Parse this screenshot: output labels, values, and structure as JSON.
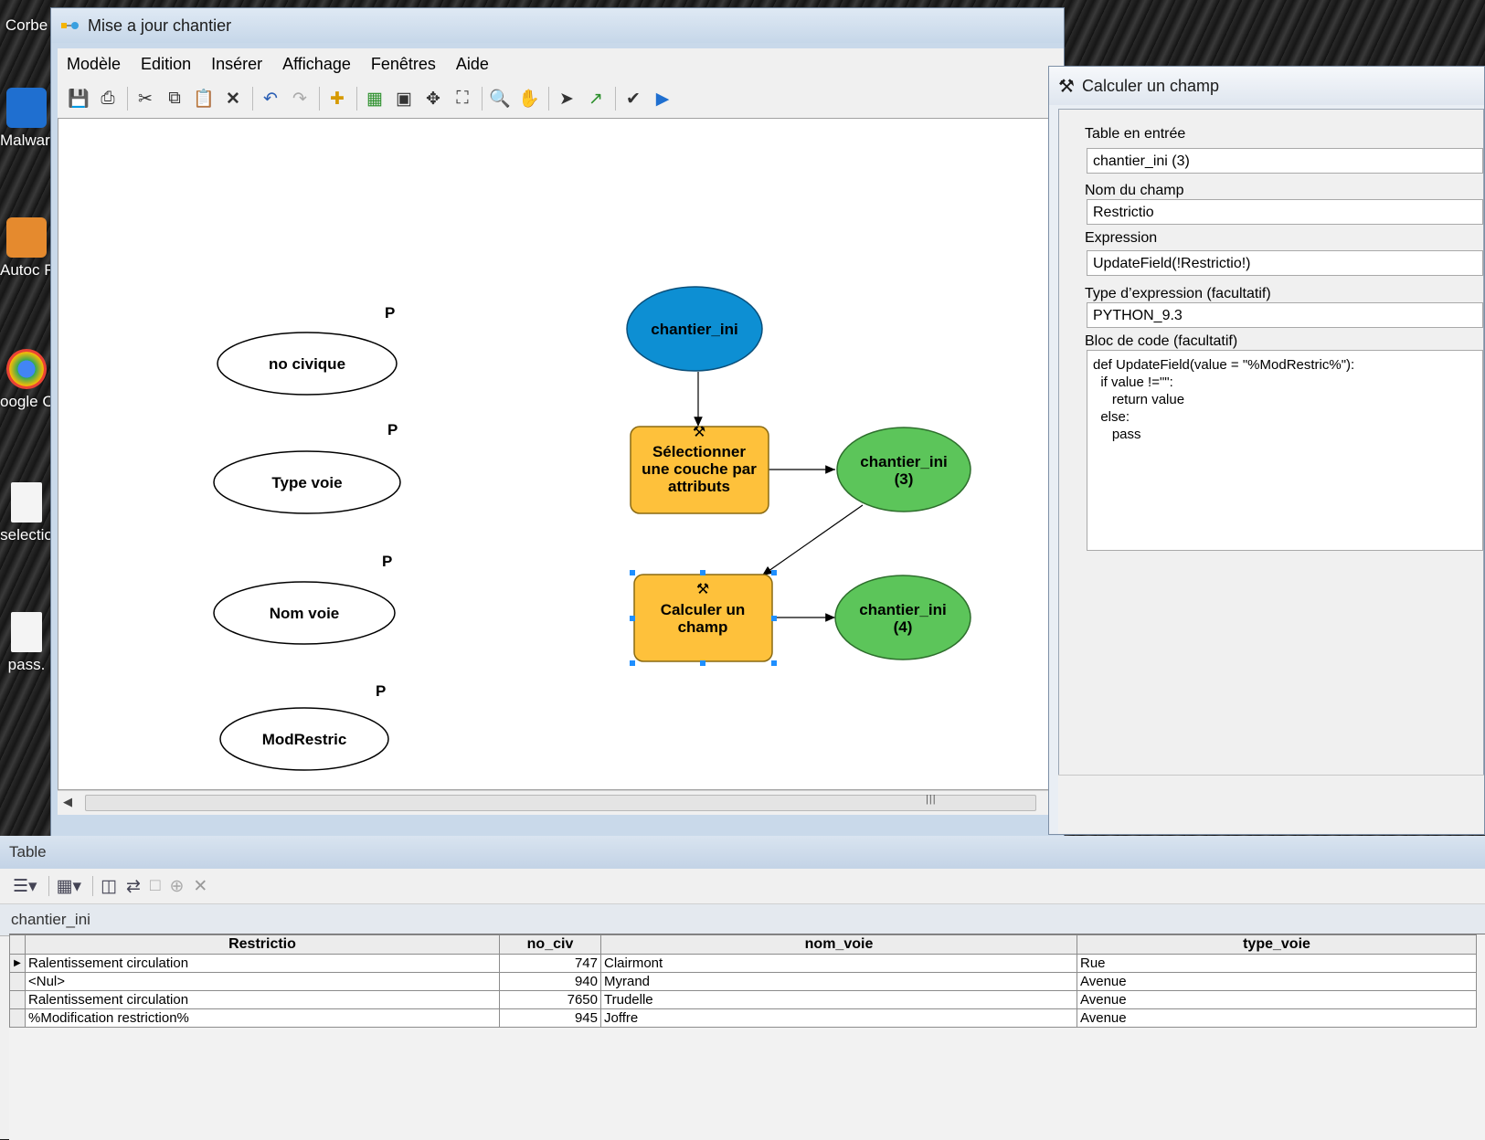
{
  "desktop": {
    "icons": [
      {
        "label": "Corbe"
      },
      {
        "label": "Malware"
      },
      {
        "label": "Autoc ReM"
      },
      {
        "label": "oogle C"
      },
      {
        "label": "selectio"
      },
      {
        "label": "pass."
      }
    ]
  },
  "model_window": {
    "title": "Mise a jour chantier",
    "menu": [
      "Modèle",
      "Edition",
      "Insérer",
      "Affichage",
      "Fenêtres",
      "Aide"
    ],
    "toolbar_icons": [
      "save-icon",
      "print-icon",
      "cut-icon",
      "copy-icon",
      "paste-icon",
      "delete-icon",
      "undo-icon",
      "redo-icon",
      "add-data-icon",
      "auto-layout-icon",
      "full-extent-icon",
      "zoom-in-fixed-icon",
      "zoom-out-fixed-icon",
      "zoom-in-icon",
      "pan-icon",
      "select-icon",
      "connect-icon",
      "validate-icon",
      "run-icon"
    ],
    "parameters": [
      {
        "label": "no civique",
        "badge": "P"
      },
      {
        "label": "Type voie",
        "badge": "P"
      },
      {
        "label": "Nom voie",
        "badge": "P"
      },
      {
        "label": "ModRestric",
        "badge": "P"
      }
    ],
    "nodes": {
      "input_data": "chantier_ini",
      "tool_select_lines": [
        "Sélectionner",
        "une couche par",
        "attributs"
      ],
      "output_select_lines": [
        "chantier_ini",
        "(3)"
      ],
      "tool_calc_lines": [
        "Calculer un",
        "champ"
      ],
      "output_calc_lines": [
        "chantier_ini",
        "(4)"
      ]
    },
    "colors": {
      "input_fill": "#0d8fd3",
      "tool_fill": "#fec13b",
      "output_fill": "#5cc55a",
      "parameter_fill": "#ffffff"
    }
  },
  "dialog": {
    "title": "Calculer un champ",
    "fields": {
      "table_label": "Table en entrée",
      "table_value": "chantier_ini (3)",
      "field_label": "Nom du champ",
      "field_value": "Restrictio",
      "expression_label": "Expression",
      "expression_value": "UpdateField(!Restrictio!)",
      "type_label": "Type d’expression (facultatif)",
      "type_value": "PYTHON_9.3",
      "code_label": "Bloc de code (facultatif)",
      "code_value": "def UpdateField(value = \"%ModRestric%\"):\n  if value !=\"\":\n     return value\n  else:\n     pass"
    }
  },
  "table_window": {
    "title": "Table",
    "tab_name": "chantier_ini",
    "columns": [
      "Restrictio",
      "no_civ",
      "nom_voie",
      "type_voie"
    ],
    "rows": [
      {
        "Restrictio": "Ralentissement circulation",
        "no_civ": "747",
        "nom_voie": "Clairmont",
        "type_voie": "Rue"
      },
      {
        "Restrictio": "<Nul>",
        "no_civ": "940",
        "nom_voie": "Myrand",
        "type_voie": "Avenue"
      },
      {
        "Restrictio": "Ralentissement circulation",
        "no_civ": "7650",
        "nom_voie": "Trudelle",
        "type_voie": "Avenue"
      },
      {
        "Restrictio": "%Modification restriction%",
        "no_civ": "945",
        "nom_voie": "Joffre",
        "type_voie": "Avenue"
      }
    ]
  }
}
